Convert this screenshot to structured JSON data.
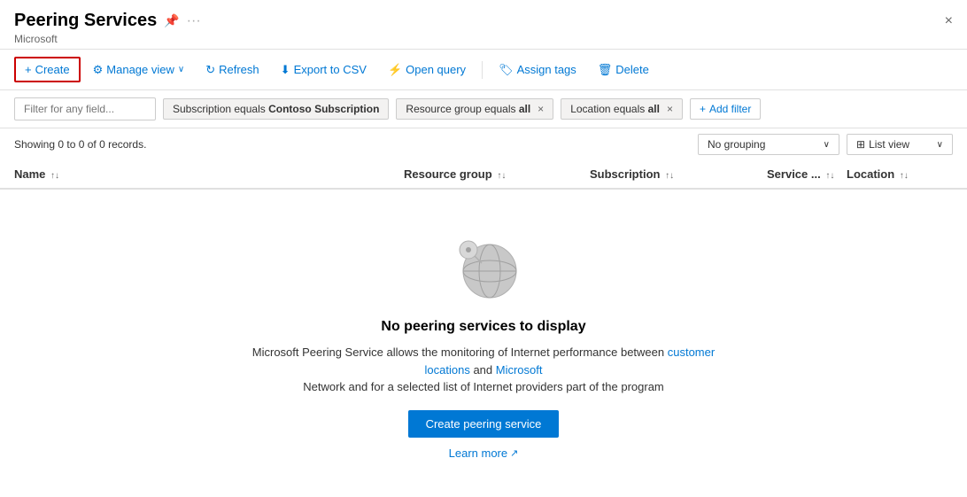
{
  "header": {
    "title": "Peering Services",
    "subtitle": "Microsoft",
    "close_label": "×"
  },
  "toolbar": {
    "create_label": "Create",
    "manage_view_label": "Manage view",
    "refresh_label": "Refresh",
    "export_label": "Export to CSV",
    "open_query_label": "Open query",
    "assign_tags_label": "Assign tags",
    "delete_label": "Delete"
  },
  "filters": {
    "placeholder": "Filter for any field...",
    "tags": [
      {
        "label": "Subscription equals ",
        "value": "Contoso Subscription",
        "closeable": false
      },
      {
        "label": "Resource group equals ",
        "value": "all",
        "closeable": true
      },
      {
        "label": "Location equals ",
        "value": "all",
        "closeable": true
      }
    ],
    "add_filter_label": "Add filter"
  },
  "records": {
    "text": "Showing 0 to 0 of 0 records.",
    "grouping_label": "No grouping",
    "listview_label": "List view"
  },
  "table": {
    "columns": [
      {
        "id": "name",
        "label": "Name"
      },
      {
        "id": "resource_group",
        "label": "Resource group"
      },
      {
        "id": "subscription",
        "label": "Subscription"
      },
      {
        "id": "service",
        "label": "Service ..."
      },
      {
        "id": "location",
        "label": "Location"
      }
    ]
  },
  "empty_state": {
    "title": "No peering services to display",
    "description_1": "Microsoft Peering Service allows the monitoring of Internet performance between ",
    "description_link1": "customer locations",
    "description_2": " and ",
    "description_link2": "Microsoft",
    "description_3": "\nNetwork and for a selected list of Internet providers part of the program",
    "create_label": "Create peering service",
    "learn_more_label": "Learn more"
  },
  "icons": {
    "pin": "📌",
    "more": "···",
    "gear": "⚙",
    "refresh": "↻",
    "download": "⬇",
    "query": "⚡",
    "tag": "🏷",
    "trash": "🗑",
    "plus": "+",
    "sort": "↑↓",
    "chevron_down": "∨",
    "grid": "⊞",
    "add_filter": "+"
  }
}
